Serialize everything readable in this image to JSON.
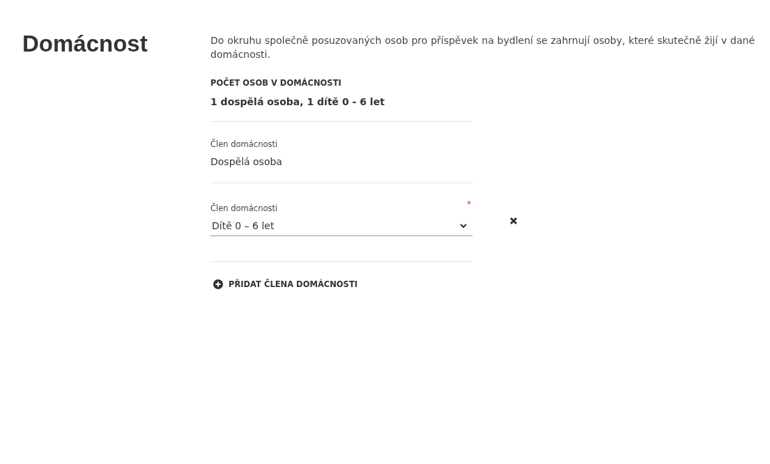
{
  "title": "Domácnost",
  "intro": "Do okruhu společně posuzovaných osob pro příspěvek na bydlení se zahrnují osoby, které skutečně žijí v dané domácnosti.",
  "count": {
    "label": "POČET OSOB V DOMÁCNOSTI",
    "value": "1 dospělá osoba, 1 dítě 0 - 6 let"
  },
  "members": [
    {
      "kind": "static",
      "label": "Člen domácnosti",
      "value": "Dospělá osoba",
      "removable": false
    },
    {
      "kind": "select",
      "label": "Člen domácnosti",
      "value": "Dítě 0 – 6 let",
      "required_mark": "*",
      "removable": true
    }
  ],
  "add_button": "PŘIDAT ČLENA DOMÁCNOSTI"
}
